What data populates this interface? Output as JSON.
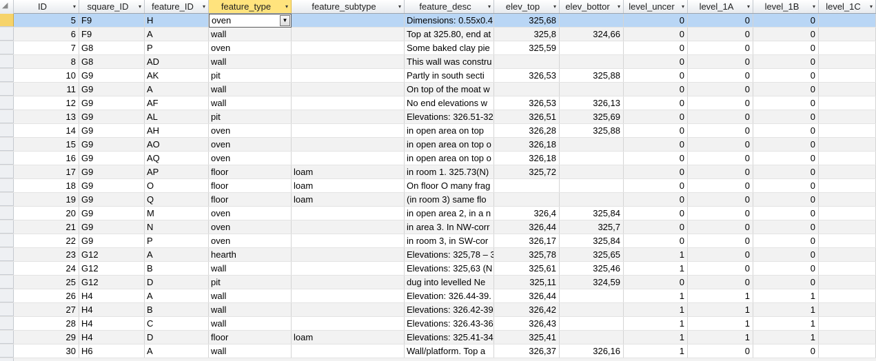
{
  "columns": [
    {
      "label": "ID"
    },
    {
      "label": "square_ID"
    },
    {
      "label": "feature_ID"
    },
    {
      "label": "feature_type"
    },
    {
      "label": "feature_subtype"
    },
    {
      "label": "feature_desc"
    },
    {
      "label": "elev_top"
    },
    {
      "label": "elev_bottor"
    },
    {
      "label": "level_uncer"
    },
    {
      "label": "level_1A"
    },
    {
      "label": "level_1B"
    },
    {
      "label": "level_1C"
    }
  ],
  "active_column": "feature_type",
  "dropdown_arrow_icon": "chevron-down-icon",
  "selected_row_index": 0,
  "rows": [
    {
      "id": "5",
      "square": "F9",
      "feature": "H",
      "type": "oven",
      "subtype": "",
      "desc": "Dimensions: 0.55x0.4",
      "top": "325,68",
      "bottom": "",
      "uncer": "0",
      "l1a": "0",
      "l1b": "0"
    },
    {
      "id": "6",
      "square": "F9",
      "feature": "A",
      "type": "wall",
      "subtype": "",
      "desc": "Top at 325.80, end at",
      "top": "325,8",
      "bottom": "324,66",
      "uncer": "0",
      "l1a": "0",
      "l1b": "0"
    },
    {
      "id": "7",
      "square": "G8",
      "feature": "P",
      "type": "oven",
      "subtype": "",
      "desc": "Some baked clay pie",
      "top": "325,59",
      "bottom": "",
      "uncer": "0",
      "l1a": "0",
      "l1b": "0"
    },
    {
      "id": "8",
      "square": "G8",
      "feature": "AD",
      "type": "wall",
      "subtype": "",
      "desc": "This wall was constru",
      "top": "",
      "bottom": "",
      "uncer": "0",
      "l1a": "0",
      "l1b": "0"
    },
    {
      "id": "10",
      "square": "G9",
      "feature": "AK",
      "type": "pit",
      "subtype": "",
      "desc": "Partly in south secti",
      "top": "326,53",
      "bottom": "325,88",
      "uncer": "0",
      "l1a": "0",
      "l1b": "0"
    },
    {
      "id": "11",
      "square": "G9",
      "feature": "A",
      "type": "wall",
      "subtype": "",
      "desc": "On top of the moat w",
      "top": "",
      "bottom": "",
      "uncer": "0",
      "l1a": "0",
      "l1b": "0"
    },
    {
      "id": "12",
      "square": "G9",
      "feature": "AF",
      "type": "wall",
      "subtype": "",
      "desc": "No end elevations w",
      "top": "326,53",
      "bottom": "326,13",
      "uncer": "0",
      "l1a": "0",
      "l1b": "0"
    },
    {
      "id": "13",
      "square": "G9",
      "feature": "AL",
      "type": "pit",
      "subtype": "",
      "desc": "Elevations: 326.51-32",
      "top": "326,51",
      "bottom": "325,69",
      "uncer": "0",
      "l1a": "0",
      "l1b": "0"
    },
    {
      "id": "14",
      "square": "G9",
      "feature": "AH",
      "type": "oven",
      "subtype": "",
      "desc": "in open area  on top",
      "top": "326,28",
      "bottom": "325,88",
      "uncer": "0",
      "l1a": "0",
      "l1b": "0"
    },
    {
      "id": "15",
      "square": "G9",
      "feature": "AO",
      "type": "oven",
      "subtype": "",
      "desc": "in open area on top o",
      "top": "326,18",
      "bottom": "",
      "uncer": "0",
      "l1a": "0",
      "l1b": "0"
    },
    {
      "id": "16",
      "square": "G9",
      "feature": "AQ",
      "type": "oven",
      "subtype": "",
      "desc": "in open area on top o",
      "top": "326,18",
      "bottom": "",
      "uncer": "0",
      "l1a": "0",
      "l1b": "0"
    },
    {
      "id": "17",
      "square": "G9",
      "feature": "AP",
      "type": "floor",
      "subtype": "loam",
      "desc": "in room 1.  325.73(N)",
      "top": "325,72",
      "bottom": "",
      "uncer": "0",
      "l1a": "0",
      "l1b": "0"
    },
    {
      "id": "18",
      "square": "G9",
      "feature": "O",
      "type": "floor",
      "subtype": "loam",
      "desc": "On floor O many frag",
      "top": "",
      "bottom": "",
      "uncer": "0",
      "l1a": "0",
      "l1b": "0"
    },
    {
      "id": "19",
      "square": "G9",
      "feature": "Q",
      "type": "floor",
      "subtype": "loam",
      "desc": "(in room 3) same flo",
      "top": "",
      "bottom": "",
      "uncer": "0",
      "l1a": "0",
      "l1b": "0"
    },
    {
      "id": "20",
      "square": "G9",
      "feature": "M",
      "type": "oven",
      "subtype": "",
      "desc": "in open area 2, in a n",
      "top": "326,4",
      "bottom": "325,84",
      "uncer": "0",
      "l1a": "0",
      "l1b": "0"
    },
    {
      "id": "21",
      "square": "G9",
      "feature": "N",
      "type": "oven",
      "subtype": "",
      "desc": "in area 3. In NW-corr",
      "top": "326,44",
      "bottom": "325,7",
      "uncer": "0",
      "l1a": "0",
      "l1b": "0"
    },
    {
      "id": "22",
      "square": "G9",
      "feature": "P",
      "type": "oven",
      "subtype": "",
      "desc": "in  room 3, in SW-cor",
      "top": "326,17",
      "bottom": "325,84",
      "uncer": "0",
      "l1a": "0",
      "l1b": "0"
    },
    {
      "id": "23",
      "square": "G12",
      "feature": "A",
      "type": "hearth",
      "subtype": "",
      "desc": "Elevations: 325,78 – 3",
      "top": "325,78",
      "bottom": "325,65",
      "uncer": "1",
      "l1a": "0",
      "l1b": "0"
    },
    {
      "id": "24",
      "square": "G12",
      "feature": "B",
      "type": "wall",
      "subtype": "",
      "desc": "Elevations: 325,63 (N",
      "top": "325,61",
      "bottom": "325,46",
      "uncer": "1",
      "l1a": "0",
      "l1b": "0"
    },
    {
      "id": "25",
      "square": "G12",
      "feature": "D",
      "type": "pit",
      "subtype": "",
      "desc": "dug into levelled Ne",
      "top": "325,11",
      "bottom": "324,59",
      "uncer": "0",
      "l1a": "0",
      "l1b": "0"
    },
    {
      "id": "26",
      "square": "H4",
      "feature": "A",
      "type": "wall",
      "subtype": "",
      "desc": "Elevation: 326.44-39.",
      "top": "326,44",
      "bottom": "",
      "uncer": "1",
      "l1a": "1",
      "l1b": "1"
    },
    {
      "id": "27",
      "square": "H4",
      "feature": "B",
      "type": "wall",
      "subtype": "",
      "desc": "Elevations: 326.42-39.",
      "top": "326,42",
      "bottom": "",
      "uncer": "1",
      "l1a": "1",
      "l1b": "1"
    },
    {
      "id": "28",
      "square": "H4",
      "feature": "C",
      "type": "wall",
      "subtype": "",
      "desc": "Elevations: 326.43-36",
      "top": "326,43",
      "bottom": "",
      "uncer": "1",
      "l1a": "1",
      "l1b": "1"
    },
    {
      "id": "29",
      "square": "H4",
      "feature": "D",
      "type": "floor",
      "subtype": "loam",
      "desc": "Elevations: 325.41-34",
      "top": "325,41",
      "bottom": "",
      "uncer": "1",
      "l1a": "1",
      "l1b": "1"
    },
    {
      "id": "30",
      "square": "H6",
      "feature": "A",
      "type": "wall",
      "subtype": "",
      "desc": "Wall/platform. Top a",
      "top": "326,37",
      "bottom": "326,16",
      "uncer": "1",
      "l1a": "0",
      "l1b": "0"
    }
  ]
}
